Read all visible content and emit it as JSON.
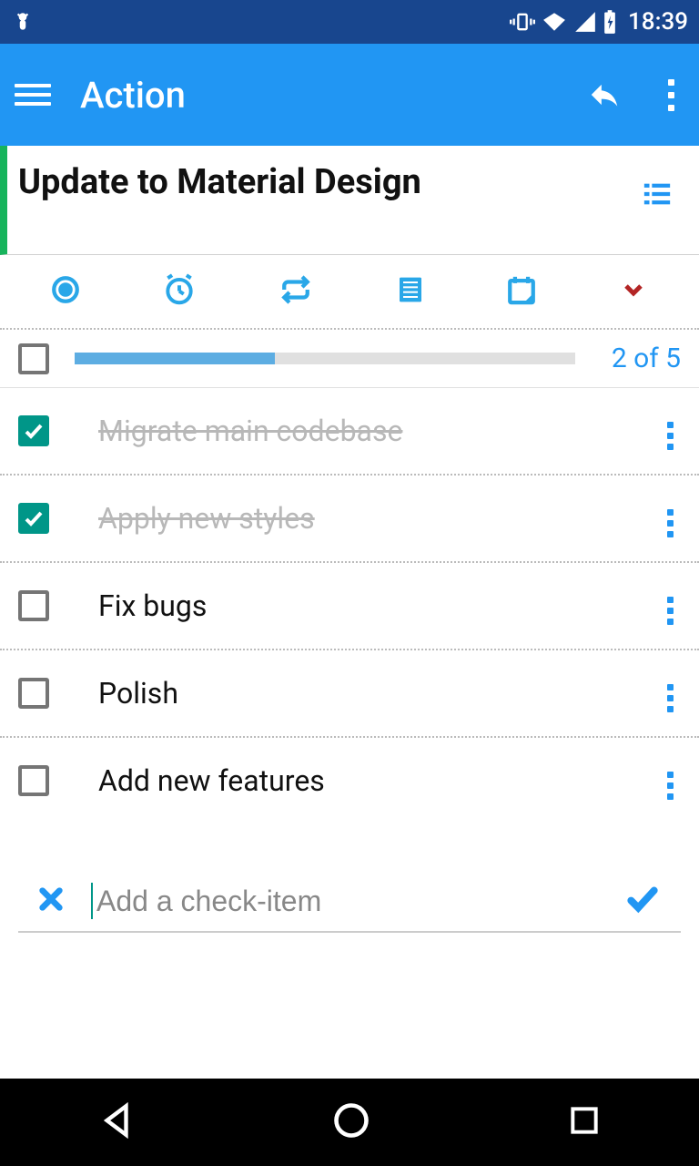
{
  "status": {
    "time": "18:39"
  },
  "appbar": {
    "title": "Action"
  },
  "task": {
    "title": "Update to Material Design"
  },
  "progress": {
    "label": "2 of 5",
    "percent": 40
  },
  "items": [
    {
      "label": "Migrate main codebase",
      "done": true
    },
    {
      "label": "Apply new styles",
      "done": true
    },
    {
      "label": "Fix bugs",
      "done": false
    },
    {
      "label": "Polish",
      "done": false
    },
    {
      "label": "Add new features",
      "done": false
    }
  ],
  "add": {
    "placeholder": "Add a check-item"
  }
}
